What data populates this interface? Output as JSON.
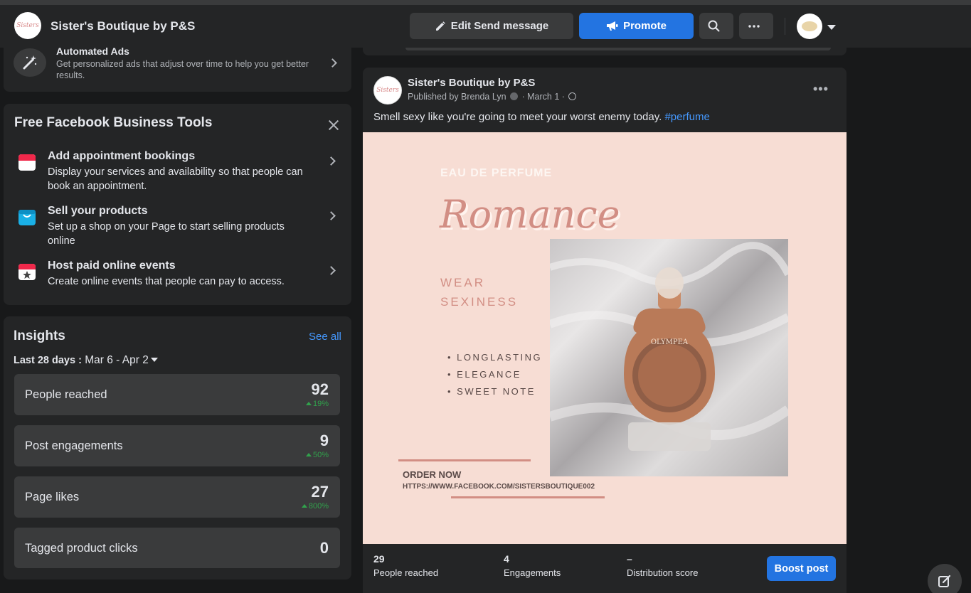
{
  "header": {
    "page_name": "Sister's Boutique by P&S",
    "logo_text": "Sisters",
    "edit_button_label": "Edit Send message",
    "promote_button_label": "Promote"
  },
  "automated_ads": {
    "title": "Automated Ads",
    "description": "Get personalized ads that adjust over time to help you get better results."
  },
  "business_tools": {
    "title": "Free Facebook Business Tools",
    "items": [
      {
        "title": "Add appointment bookings",
        "description": "Display your services and availability so that people can book an appointment.",
        "icon": "calendar-icon"
      },
      {
        "title": "Sell your products",
        "description": "Set up a shop on your Page to start selling products online",
        "icon": "shopping-bag-icon"
      },
      {
        "title": "Host paid online events",
        "description": "Create online events that people can pay to access.",
        "icon": "event-star-icon"
      }
    ]
  },
  "insights": {
    "title": "Insights",
    "see_all": "See all",
    "range_label": "Last 28 days :",
    "range_value": "Mar 6 - Apr 2",
    "stats": [
      {
        "label": "People reached",
        "value": "92",
        "change": "19%"
      },
      {
        "label": "Post engagements",
        "value": "9",
        "change": "50%"
      },
      {
        "label": "Page likes",
        "value": "27",
        "change": "800%"
      },
      {
        "label": "Tagged product clicks",
        "value": "0",
        "change": ""
      }
    ]
  },
  "post": {
    "author": "Sister's Boutique by P&S",
    "meta": "Published by Brenda Lyn",
    "date": "March 1",
    "text": "Smell sexy like you're going to meet your worst enemy today.",
    "hashtag": "#perfume",
    "image": {
      "eau": "EAU DE PERFUME",
      "title": "Romance",
      "wear_line1": "WEAR",
      "wear_line2": "SEXINESS",
      "bullets": [
        "• LONGLASTING",
        "• ELEGANCE",
        "• SWEET NOTE"
      ],
      "order": "ORDER NOW",
      "url": "HTTPS://WWW.FACEBOOK.COM/SISTERSBOUTIQUE002",
      "bottle_label": "OLYMPEA"
    },
    "stats": [
      {
        "value": "29",
        "label": "People reached"
      },
      {
        "value": "4",
        "label": "Engagements"
      },
      {
        "value": "–",
        "label": "Distribution score"
      }
    ],
    "boost_label": "Boost post"
  },
  "colors": {
    "background": "#18191a",
    "card": "#242526",
    "accent": "#2374e1",
    "link": "#4599ff",
    "positive": "#31a24c"
  }
}
